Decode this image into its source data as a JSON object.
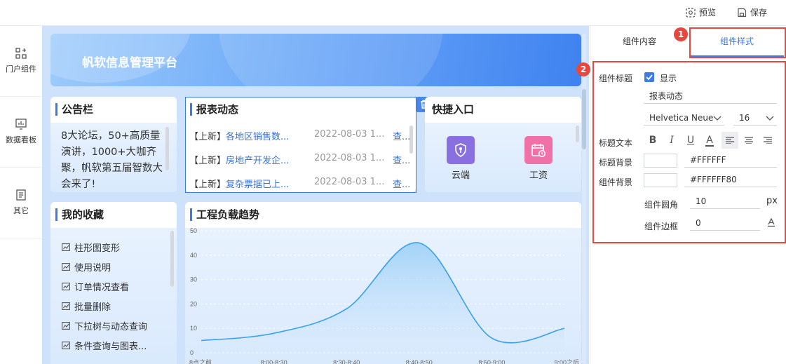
{
  "toolbar": {
    "preview_label": "预览",
    "save_label": "保存"
  },
  "sidebar": {
    "items": [
      {
        "label": "门户组件",
        "icon": "components-icon"
      },
      {
        "label": "数据看板",
        "icon": "dashboard-icon"
      },
      {
        "label": "其它",
        "icon": "document-icon"
      }
    ]
  },
  "banner": {
    "title": "帆软信息管理平台"
  },
  "notice": {
    "title": "公告栏",
    "text": "8大论坛，50+高质量演讲，1000+大咖齐聚，帆软第五届智数大会来了!"
  },
  "reports": {
    "title": "报表动态",
    "rows": [
      {
        "tag": "【上新】",
        "name": "各地区销售数...",
        "date": "2022-08-03 1...",
        "action": "查..."
      },
      {
        "tag": "【上新】",
        "name": "房地产开发企...",
        "date": "2022-08-03 1...",
        "action": "查..."
      },
      {
        "tag": "【上新】",
        "name": "复杂票据已上...",
        "date": "2022-08-03 1...",
        "action": "查..."
      }
    ]
  },
  "quick": {
    "title": "快捷入口",
    "items": [
      {
        "label": "云端",
        "icon": "cloud-shield-icon",
        "color": "#8a6fe0"
      },
      {
        "label": "工资",
        "icon": "calendar-clock-icon",
        "color": "#f070a8"
      }
    ]
  },
  "favorites": {
    "title": "我的收藏",
    "items": [
      "柱形图变形",
      "使用说明",
      "订单情况查看",
      "批量删除",
      "下拉树与动态查询",
      "条件查询与图表..."
    ]
  },
  "chart_data": {
    "type": "area",
    "title": "工程负载趋势",
    "categories": [
      "8点之前",
      "8:00-8:30",
      "8:30-8:40",
      "8:40-8:50",
      "8:50-9:00",
      "9:00之后"
    ],
    "x_ticks": [
      "8点之前",
      "8:00-8:30",
      "8:30-8:40",
      "8:40-8:50",
      "8:50-9:00",
      "9:00之后"
    ],
    "y_ticks": [
      "0",
      "10",
      "20",
      "30",
      "40",
      "50"
    ],
    "values": [
      5,
      8,
      18,
      45,
      6,
      10
    ],
    "ylim": [
      0,
      50
    ],
    "color": "#3aa0e8"
  },
  "props": {
    "tab_content": "组件内容",
    "tab_style": "组件样式",
    "badge1": "1",
    "badge2": "2",
    "title_label": "组件标题",
    "show_label": "显示",
    "title_value": "报表动态",
    "font_family": "Helvetica Neue",
    "font_size": "16",
    "title_text_label": "标题文本",
    "title_bg_label": "标题背景",
    "title_bg_value": "#FFFFFF",
    "comp_bg_label": "组件背景",
    "comp_bg_value": "#FFFFFF80",
    "radius_label": "组件圆角",
    "radius_value": "10",
    "radius_unit": "px",
    "border_label": "组件边框",
    "border_value": "0",
    "accent": "#3d7ae8",
    "highlight": "#e8473f"
  }
}
